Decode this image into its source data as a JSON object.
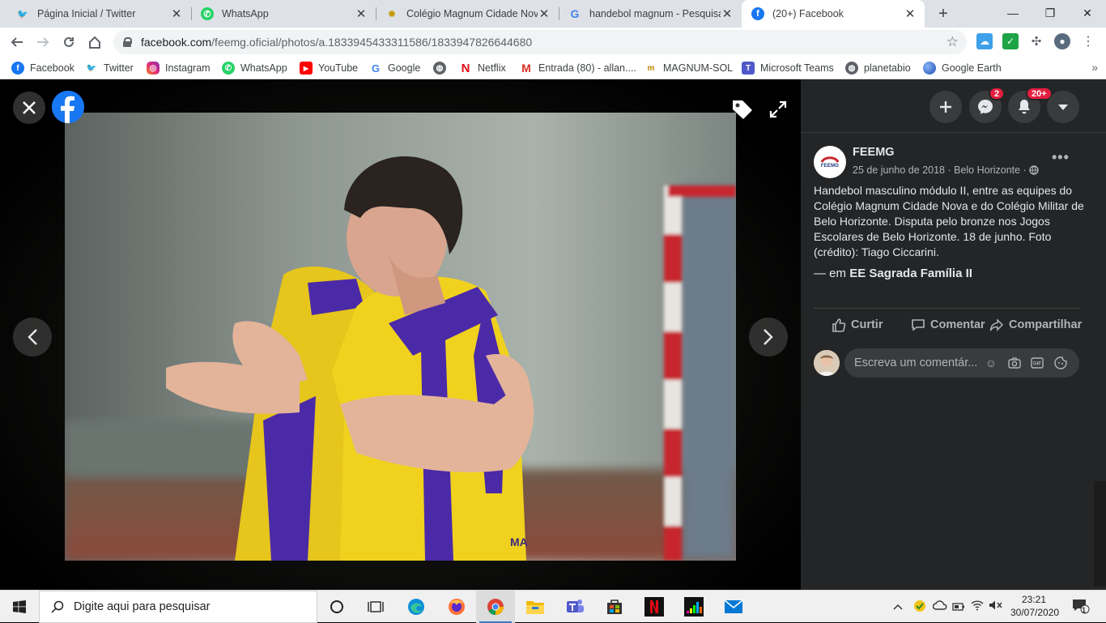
{
  "browser": {
    "tabs": [
      {
        "title": "Página Inicial / Twitter",
        "icon": "twitter-icon"
      },
      {
        "title": "WhatsApp",
        "icon": "whatsapp-icon"
      },
      {
        "title": "Colégio Magnum Cidade Nova",
        "icon": "magnum-icon"
      },
      {
        "title": "handebol magnum - Pesquisa G",
        "icon": "google-icon"
      },
      {
        "title": "(20+) Facebook",
        "icon": "facebook-icon"
      }
    ],
    "url_host": "facebook.com",
    "url_path": "/feemg.oficial/photos/a.1833945433311586/1833947826644680"
  },
  "bookmarks": [
    {
      "label": "Facebook",
      "icon": "facebook-icon"
    },
    {
      "label": "Twitter",
      "icon": "twitter-icon"
    },
    {
      "label": "Instagram",
      "icon": "instagram-icon"
    },
    {
      "label": "WhatsApp",
      "icon": "whatsapp-icon"
    },
    {
      "label": "YouTube",
      "icon": "youtube-icon"
    },
    {
      "label": "Google",
      "icon": "google-icon"
    },
    {
      "label": "",
      "icon": "globe-icon"
    },
    {
      "label": "Netflix",
      "icon": "netflix-icon"
    },
    {
      "label": "Entrada (80) - allan....",
      "icon": "gmail-icon"
    },
    {
      "label": "MAGNUM-SOL",
      "icon": "magnum-icon"
    },
    {
      "label": "Microsoft Teams",
      "icon": "teams-icon"
    },
    {
      "label": "planetabio",
      "icon": "globe-icon"
    },
    {
      "label": "Google Earth",
      "icon": "google-earth-icon"
    }
  ],
  "header": {
    "messenger_badge": "2",
    "notifications_badge": "20+"
  },
  "post": {
    "author": "FEEMG",
    "avatar_text": "FEEMG",
    "date": "25 de junho de 2018",
    "place": "Belo Horizonte",
    "caption": "Handebol masculino módulo II, entre as equipes do Colégio Magnum Cidade Nova e do Colégio Militar de Belo Horizonte. Disputa pelo bronze nos Jogos Escolares de Belo Horizonte. 18 de junho. Foto (crédito): Tiago Ciccarini.",
    "location_prefix": "— em",
    "location_name": "EE Sagrada Família II"
  },
  "actions": {
    "like": "Curtir",
    "comment": "Comentar",
    "share": "Compartilhar"
  },
  "comment": {
    "placeholder": "Escreva um comentár..."
  },
  "taskbar": {
    "search_placeholder": "Digite aqui para pesquisar",
    "time": "23:21",
    "date": "30/07/2020",
    "notifications_count": "1"
  },
  "colors": {
    "facebook_blue": "#1877f2",
    "panel_bg": "#242526",
    "jersey_yellow": "#f0d21e",
    "jersey_purple": "#4b2aa8",
    "badge_red": "#e41e3f"
  }
}
